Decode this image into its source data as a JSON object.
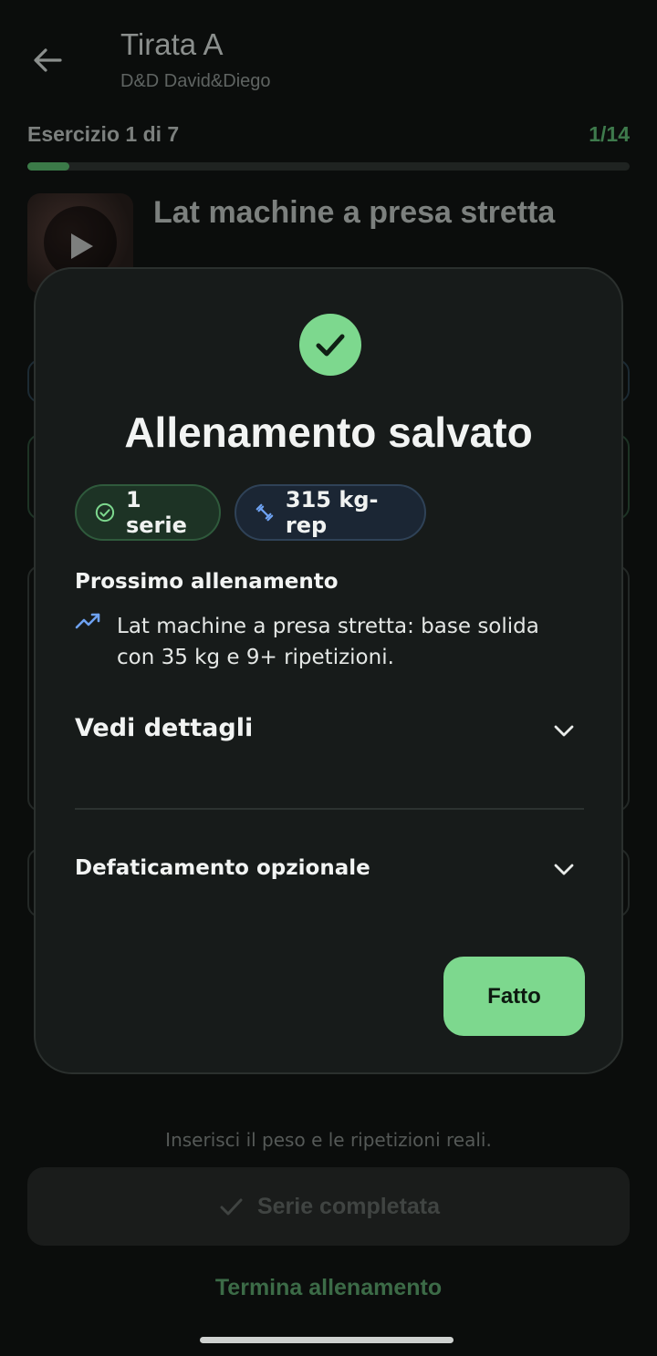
{
  "header": {
    "title": "Tirata A",
    "subtitle": "D&D David&Diego"
  },
  "progress": {
    "exercise_label": "Esercizio 1 di 7",
    "set_label": "1/14",
    "fraction": 0.07
  },
  "exercise": {
    "name": "Lat machine a presa stretta"
  },
  "dialog": {
    "title": "Allenamento salvato",
    "chips": {
      "series": "1 serie",
      "volume": "315 kg-rep"
    },
    "next_heading": "Prossimo allenamento",
    "next_text": "Lat machine a presa stretta: base solida con 35 kg e 9+ ripetizioni.",
    "details_label": "Vedi dettagli",
    "cooldown_label": "Defaticamento opzionale",
    "done_label": "Fatto"
  },
  "footer": {
    "hint": "Inserisci il peso e le ripetizioni reali.",
    "complete_label": "Serie completata",
    "end_label": "Termina allenamento"
  },
  "icons": {
    "back": "arrow-left-icon",
    "check": "check-circle-icon",
    "series": "check-circle-outline-icon",
    "volume": "dumbbell-icon",
    "trend": "trending-up-icon",
    "chevron": "chevron-down-icon"
  },
  "colors": {
    "accent": "#7dd88e",
    "background": "#0b0d0c",
    "dialog": "#171b1a",
    "trend": "#6ea2f2"
  }
}
